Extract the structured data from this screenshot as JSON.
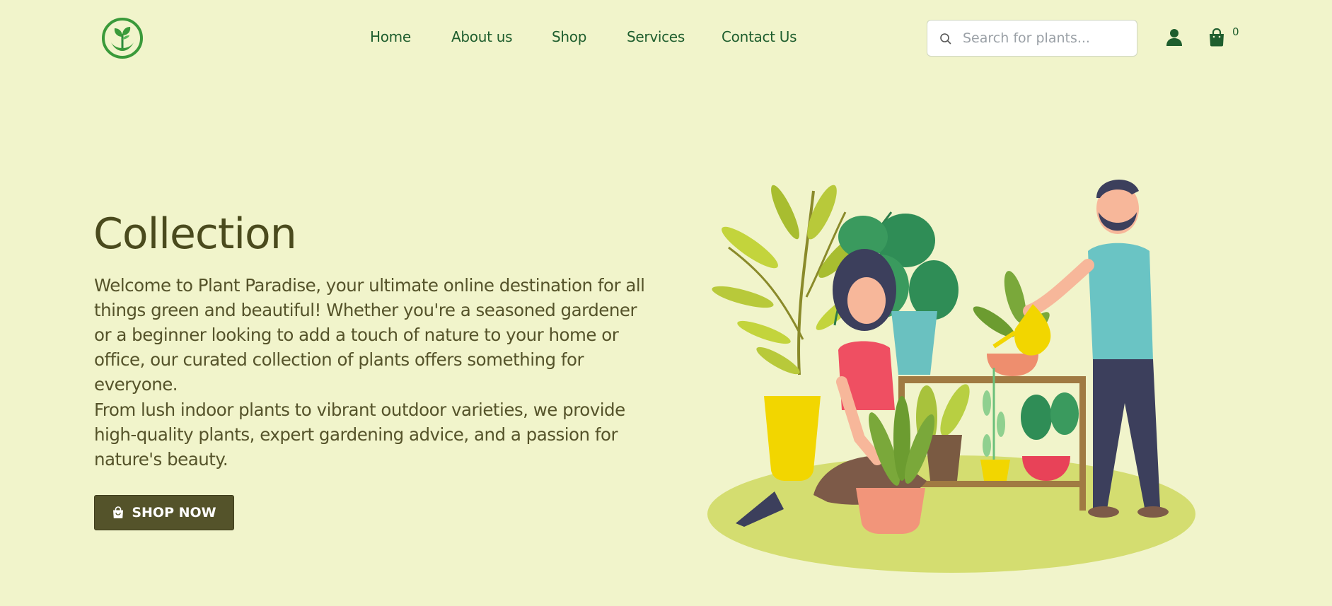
{
  "brand": {
    "logo_icon": "plant-sprout-in-hands-icon",
    "accent": "#2e8b3c"
  },
  "nav": {
    "items": [
      {
        "label": "Home"
      },
      {
        "label": "About us"
      },
      {
        "label": "Shop"
      },
      {
        "label": "Services"
      },
      {
        "label": "Contact Us"
      }
    ]
  },
  "search": {
    "placeholder": "Search for plants...",
    "value": "",
    "icon": "search-icon"
  },
  "header_actions": {
    "user_icon": "user-icon",
    "cart_icon": "shopping-bag-icon",
    "cart_count": "0"
  },
  "hero": {
    "title": "Collection",
    "paragraph_1": "Welcome to Plant Paradise, your ultimate online destination for all things green and beautiful! Whether you're a seasoned gardener or a beginner looking to add a touch of nature to your home or office, our curated collection of plants offers something for everyone.",
    "paragraph_2": "From lush indoor plants to vibrant outdoor varieties, we provide high-quality plants, expert gardening advice, and a passion for nature's beauty.",
    "cta_label": "SHOP NOW",
    "cta_icon": "shopping-bag-icon",
    "illustration": "people-gardening-illustration"
  },
  "colors": {
    "background": "#f1f4cb",
    "nav_text": "#1f5e2e",
    "heading": "#4a4a1d",
    "button_bg": "#54532a"
  }
}
